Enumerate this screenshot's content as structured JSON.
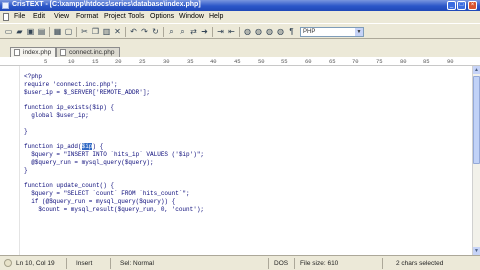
{
  "window": {
    "title": "CrisTEXT - [C:\\xampp\\htdocs\\series\\database\\index.php]",
    "controls": {
      "minimize": "_",
      "maximize": "□",
      "close": "×"
    }
  },
  "menu": {
    "items": [
      "File",
      "Edit",
      "View",
      "Format",
      "Project",
      "Tools",
      "Options",
      "Window",
      "Help"
    ]
  },
  "toolbar": {
    "icons": [
      "new-file-icon",
      "open-folder-icon",
      "save-icon",
      "save-all-icon",
      "print-icon",
      "preview-icon",
      "cut-icon",
      "copy-icon",
      "paste-icon",
      "undo-icon",
      "redo-icon",
      "find-icon",
      "replace-icon",
      "find-next-icon",
      "spell-check-icon",
      "indent-icon",
      "outdent-icon",
      "bookmark-icon",
      "bookmark-next-icon",
      "bookmark-prev-icon",
      "bookmark-clear-icon",
      "word-wrap-icon"
    ],
    "language": "PHP"
  },
  "tabs": [
    {
      "label": "index.php",
      "active": true
    },
    {
      "label": "connect.inc.php",
      "active": false
    }
  ],
  "ruler": [
    "5",
    "10",
    "15",
    "20",
    "25",
    "30",
    "35",
    "40",
    "45",
    "50",
    "55",
    "60",
    "65",
    "70",
    "75",
    "80",
    "85",
    "90"
  ],
  "code": {
    "lines": [
      "<?php",
      "require 'connect.inc.php';",
      "$user_ip = $_SERVER['REMOTE_ADDR'];",
      "",
      "function ip_exists($ip) {",
      "  global $user_ip;",
      "",
      "}",
      "",
      "function ip_add(",
      "  $query = \"INSERT INTO `hits_ip` VALUES ('$ip')\";",
      "  @$query_run = mysql_query($query);",
      "}",
      "",
      "function update_count() {",
      "  $query = \"SELECT `count` FROM `hits_count`\";",
      "  if (@$query_run = mysql_query($query)) {",
      "    $count = mysql_result($query_run, 0, 'count');"
    ],
    "selection": "$ip",
    "selection_suffix": ") {"
  },
  "status": {
    "position": "Ln 10, Col 19",
    "mode": "Insert",
    "selection_mode": "Sel: Normal",
    "line_endings": "DOS",
    "file_size": "File size: 610",
    "selected": "2 chars selected"
  }
}
